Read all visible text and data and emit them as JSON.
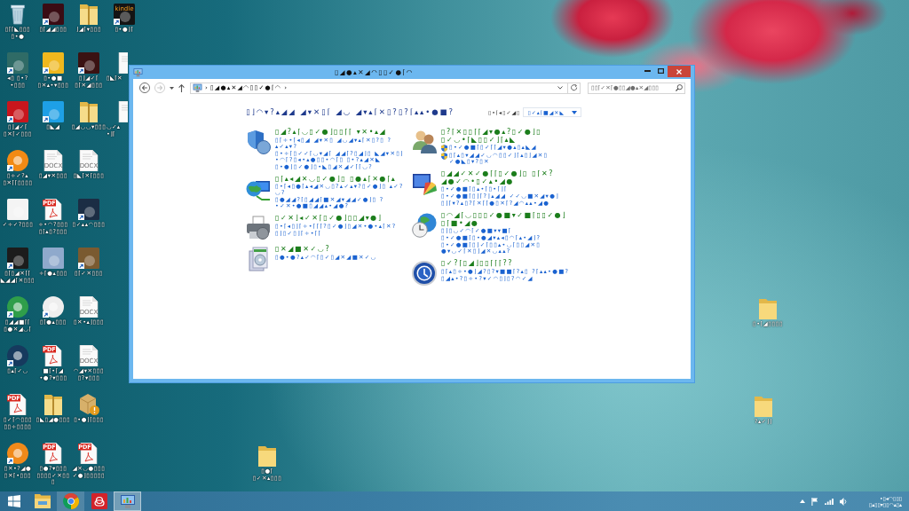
{
  "desktop": {
    "icons": [
      {
        "kind": "recycle-bin",
        "label": "▯⌈⌈◣▯▯▯ ▯•●",
        "shortcut": false
      },
      {
        "kind": "app",
        "color": "#2f6b66",
        "label": "◂▯ ▯•?•▯▯▯",
        "shortcut": true
      },
      {
        "kind": "app",
        "color": "#c8161d",
        "label": "▯⌋◢✓⌈ ▯✕⌈✓▯▯▯",
        "shortcut": true
      },
      {
        "kind": "round-app",
        "color": "#f28a14",
        "label": "▯÷✓?▴ ▯✕⌈⌈▯▯▯▯",
        "shortcut": true
      },
      {
        "kind": "app",
        "color": "#f4f4f4",
        "label": "✓÷✓?▯▯▯",
        "shortcut": false
      },
      {
        "kind": "app",
        "color": "#1c1c1c",
        "label": "▯⌈▯◢✕⌈⌈ ◣◢◢⌈✕▯▯▯",
        "shortcut": true
      },
      {
        "kind": "round-app",
        "color": "#2f9e4a",
        "label": "▯◢◢■⌈⌈ ▯●✕◢◡⌈",
        "shortcut": true
      },
      {
        "kind": "round-app",
        "color": "#163a5e",
        "label": "▯▴⌈✓◡",
        "shortcut": true
      },
      {
        "kind": "pdf",
        "badge": "PDF",
        "label": "▯✓⌈◠▯▯▯ ▯▯÷▯▯▯▯",
        "shortcut": false
      },
      {
        "kind": "round-app",
        "color": "#f08a1a",
        "label": "▯✕•?◢● ▯✕⌈•▯▯▯",
        "shortcut": true
      },
      {
        "kind": "app",
        "color": "#3a0c14",
        "label": "▯⌈◢◢▯▯▯",
        "shortcut": true
      },
      {
        "kind": "app",
        "color": "#f0b81e",
        "label": "▯•●■ ▯✕▴•▾▯▯▯",
        "shortcut": true
      },
      {
        "kind": "app",
        "color": "#1ea0e6",
        "label": "▯◣◢",
        "shortcut": true
      },
      {
        "kind": "document",
        "badge": "DOCX",
        "label": "▯◢▾✕▯▯▯",
        "shortcut": false
      },
      {
        "kind": "pdf",
        "badge": "PDF",
        "label": "÷•◠?▯▯▯ ▯⌈▴▯?▯▯▯",
        "shortcut": false
      },
      {
        "kind": "app",
        "color": "#8fa9cc",
        "label": "÷⌈●▴▯▯▯",
        "shortcut": false
      },
      {
        "kind": "round-app",
        "color": "#eeeeee",
        "label": "▯⌈●▴▯▯▯",
        "shortcut": true
      },
      {
        "kind": "pdf",
        "badge": "PDF",
        "label": "■⌈•⌈◢ •●?▾▯▯▯",
        "shortcut": false
      },
      {
        "kind": "zip-folder",
        "label": "▯◣▯◢●▯▯▯",
        "shortcut": false
      },
      {
        "kind": "pdf",
        "badge": "PDF",
        "label": "▯●?▾▯▯▯ ▯▯▯▯✓✕▯▯▯",
        "shortcut": false
      },
      {
        "kind": "zip-folder",
        "label": "⌋◢⌈▾▯▯▯",
        "shortcut": false
      },
      {
        "kind": "app",
        "color": "#3a1212",
        "label": "▯⌋◢✓⌈ ▯⌈✕◢▯▯▯",
        "shortcut": true
      },
      {
        "kind": "zip-folder",
        "label": "▯◢◡◡▾▯▯▯",
        "shortcut": false
      },
      {
        "kind": "document",
        "badge": "DOCX",
        "label": "▯◣⌈✕⌈▯▯▯",
        "shortcut": false
      },
      {
        "kind": "app",
        "color": "#1b2d44",
        "label": "▯✓▴▴◠▯▯▯",
        "shortcut": true
      },
      {
        "kind": "app",
        "color": "#7a5a30",
        "label": "▯⌈✓✕▯▯▯",
        "shortcut": true
      },
      {
        "kind": "document",
        "badge": "DOCX",
        "label": "▯✕•▴⌋▯▯▯",
        "shortcut": false
      },
      {
        "kind": "document",
        "badge": "DOCX",
        "label": "◠◢▾✕▯▯▯ ▯?▾▯▯▯",
        "shortcut": false
      },
      {
        "kind": "installer",
        "label": "▯•●⌋⌈▯▯▯",
        "shortcut": false
      },
      {
        "kind": "pdf",
        "badge": "PDF",
        "label": "◢✕◡●▯▯▯ ✓●⌋▯▯▯▯▯",
        "shortcut": false
      },
      {
        "kind": "app",
        "color": "#141414",
        "badge": "kindle",
        "label": "▯•●⌋⌈",
        "shortcut": true
      },
      {
        "kind": "document",
        "label": "▯◣⌈✕",
        "shortcut": false
      },
      {
        "kind": "document",
        "label": "◡✓▴ •⌋⌈",
        "shortcut": false
      }
    ],
    "loose_icons": [
      {
        "kind": "folder",
        "label": "▯•⌈◢▯▯▯▯",
        "shortcut": false
      },
      {
        "kind": "folder",
        "label": "?▴✓⌋⌋",
        "shortcut": false
      },
      {
        "kind": "folder",
        "label": "▯●⌈ ▯✓✕▴▯▯▯",
        "shortcut": false
      }
    ]
  },
  "window": {
    "title": "▯◢●▴✕◢◠▯▯✓●⌈◠",
    "nav": [
      {
        "kind": "back",
        "disabled": false
      },
      {
        "kind": "forward",
        "disabled": true
      },
      {
        "kind": "recent",
        "disabled": false
      },
      {
        "kind": "up",
        "disabled": false
      }
    ],
    "address": {
      "leading_separator": "›",
      "path": "▯◢●▴✕◢◠▯▯✓●⌈◠",
      "trailing_separator": "›"
    },
    "search": {
      "placeholder": "▯▯⌈✓✕⌈●▯▯◢●▴✕◢▯▯▯"
    },
    "content": {
      "heading": "▯⌋◠▾?▴◢◢ ◢▾✕▯⌈ ◢◡ ◢▾▴⌈✕▯?▯?⌈▴▴•●■?",
      "view_by": {
        "label": "▯•⌈◂▯✓◢▯",
        "value": "▯✓▴⌈■◢✕◣"
      },
      "columns": [
        {
          "categories": [
            {
              "kind": "security",
              "title": "▯◢?▴⌈◡▯✓●⌋▯▯⌈⌈ ▾✕•▴◢",
              "links": [
                {
                  "text": "▯⌈÷•⌈◂▯◢ ◢▾✕▯ ◢◡◢▾▴⌈✕▯?▯ ?▴✓▴▾?",
                  "shield": false
                },
                {
                  "text": "▯•÷⌈▯✓✓⌈◡▾◢⌈ ◢◢⌈?▯◢⌋▯ ◣◢▾✕▯⌋•◠⌈?▯◂•▴●▯▯•◠⌈▯ ▯•?▴◢✕◣",
                  "shield": false
                },
                {
                  "text": "▯•●⌋▯✓●⌋▯•◣▯◢✕◢✓⌈⌈◡?",
                  "shield": false
                }
              ]
            },
            {
              "kind": "network",
              "title": "▯⌈▴◂◢✕◡▯✓●⌋▯ ▯●▴⌈✕●⌈▴",
              "links": [
                {
                  "text": "▯•⌈◂▯●⌈▴◂◢✕◡▯?▴✓▴▾?▯✓●⌋▯ ▴✓?◡?",
                  "shield": false
                },
                {
                  "text": "▯●◢◢?⌈▯◢◢⌈■✕◢▾◢◢✓●⌋▯ ?•✓✕•●■▯◢◢▴•◢●?",
                  "shield": false
                }
              ]
            },
            {
              "kind": "hardware",
              "title": "▯✓✕⌋◂✓✕⌈▯✓●⌋▯▯◢▾●⌋",
              "links": [
                {
                  "text": "▯•⌈◂▯⌋⌈÷•⌈⌈⌈?▯✓●⌋▯◢✕•●•▴⌈✕?",
                  "shield": false
                },
                {
                  "text": "▯⌋▯✓▯⌋⌈÷•⌈⌈",
                  "shield": false
                }
              ]
            },
            {
              "kind": "programs",
              "title": "▯✕◢■✕✓◡?",
              "links": [
                {
                  "text": "▯●•●?▴✓◠⌈▯✓▯◢✕◢■✕✓◡",
                  "shield": false
                }
              ]
            }
          ]
        },
        {
          "categories": [
            {
              "kind": "users",
              "title": "▯?⌈✕▯▯⌈⌈◢▾●▴?▯✓●⌋▯ ▯✓◡•⌈◣▯▯✓⌋⌈▴◣",
              "links": [
                {
                  "text": "▯•✓●■⌈▯✓⌈⌈◢▾●▴▯▴◣◢",
                  "shield": true
                },
                {
                  "text": "▯⌈▴▯▾◢◢✓◡◠▯▯✓⌋⌈▴▯⌋◢✕▯ ✓●◣▯▾?▯✕",
                  "shield": true
                }
              ]
            },
            {
              "kind": "appearance",
              "title": "▯◢◢✓✕✓●⌈⌈▯✓●⌋▯ ▯⌈✕?◢●✓◠•▯✓▴•◢●",
              "links": [
                {
                  "text": "▯•✓●■⌈▯▴•⌈▯•⌈⌋⌈",
                  "shield": false
                },
                {
                  "text": "▯•✓●■⌈▯⌋⌈?⌋▴◢◢ ✓✓◡■✕◢▾●⌋",
                  "shield": false
                },
                {
                  "text": "▯⌋⌈▾?▴▯?⌈✕⌈⌈●▯✕⌈?◢◠▴▴•◢●",
                  "shield": false
                }
              ]
            },
            {
              "kind": "clock",
              "title": "▯◠◢⌈◡▯▯▯✓●■▾✓■⌈▯▯✓●⌋ ▯⌈■•◢●",
              "links": [
                {
                  "text": "▯⌋▯◡✓◠⌈✓●■▾▾■⌈",
                  "shield": false
                },
                {
                  "text": "▯•✓●■⌈▯•●◢▾▴◂▯◠⌈▴•◢⌋?",
                  "shield": false
                },
                {
                  "text": "▯•✓●■⌈▯⌋✓⌈▯▯▴•◡⌈▯▯◢✕▯ ●▾◡✓⌈✕▯⌋◢✕◡▴▴?",
                  "shield": false
                }
              ]
            },
            {
              "kind": "access",
              "title": "▯✓?⌈▯◢⌋▯▯⌈⌈⌈??",
              "links": [
                {
                  "text": "▯⌈▴▯÷•●⌋◢?▯?▾■■⌈?▴▯ ?⌈▴▴•●■?",
                  "shield": false
                },
                {
                  "text": "▯◢▴•?▯÷•?▾✓◠▯⌋▯?◠✓◢",
                  "shield": false
                }
              ]
            }
          ]
        }
      ]
    }
  },
  "taskbar": {
    "buttons": [
      {
        "kind": "start",
        "selected": false,
        "running": false
      },
      {
        "kind": "explorer",
        "selected": false,
        "running": false
      },
      {
        "kind": "browser",
        "selected": false,
        "running": true
      },
      {
        "kind": "creative",
        "selected": false,
        "running": false
      },
      {
        "kind": "control-panel",
        "selected": true,
        "running": true
      }
    ],
    "clock": {
      "time": "•▯◂◠▯▯▯",
      "date": "▯▴▯▯▾▯▯◠▴▯▴"
    }
  }
}
